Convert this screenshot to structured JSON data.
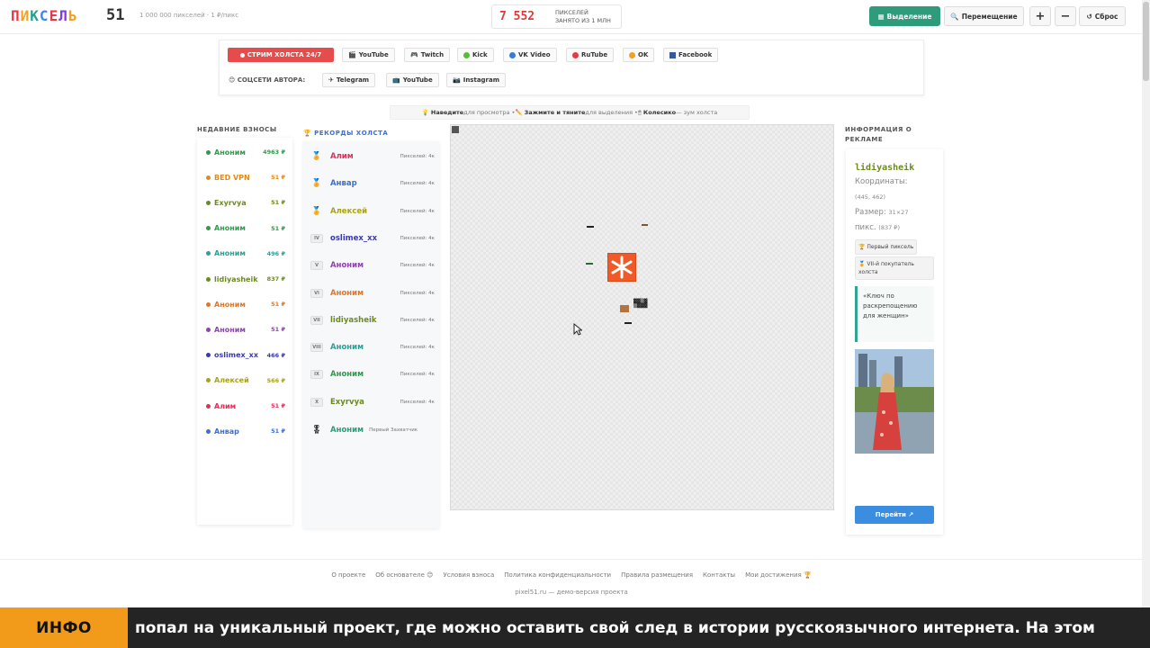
{
  "header": {
    "logo_letters": [
      "П",
      "И",
      "К",
      "С",
      "Е",
      "Л",
      "Ь"
    ],
    "logo_colors": [
      "#e63946",
      "#f4a020",
      "#2a9d8f",
      "#3a86ff",
      "#e63946",
      "#8338ec",
      "#f4a020"
    ],
    "logo_number": "51",
    "subtitle": "1 000 000 пикселей · 1 ₽/пикс",
    "counter_value": "7 552",
    "counter_caption_1": "пикселей",
    "counter_caption_2": "занято из 1 млн",
    "btn_select": "Выделение",
    "btn_move": "Перемещение",
    "btn_zoom_in": "+",
    "btn_zoom_out": "−",
    "btn_reset": "Сброс"
  },
  "streams": {
    "live_label": "СТРИМ ХОЛСТА 24/7",
    "platforms": [
      "YouTube",
      "Twitch",
      "Kick",
      "VK Video",
      "RuTube",
      "OK",
      "Facebook"
    ],
    "socials_label": "СОЦСЕТИ АВТОРА:",
    "socials": [
      "Telegram",
      "YouTube",
      "Instagram"
    ]
  },
  "hint": {
    "part1_bold": "Наведите",
    "part1": " для просмотра • ",
    "part2_bold": "Зажмите и тяните",
    "part2": " для выделения • ",
    "part3_bold": "Колесико",
    "part3": " — зум холста"
  },
  "recent": {
    "title": "Недавние взносы",
    "items": [
      {
        "name": "Аноним",
        "amount": "4963 ₽",
        "color": "#2e9c4a"
      },
      {
        "name": "BED VPN",
        "amount": "51 ₽",
        "color": "#e08a1a"
      },
      {
        "name": "Exyrvya",
        "amount": "51 ₽",
        "color": "#6c8b1e"
      },
      {
        "name": "Аноним",
        "amount": "51 ₽",
        "color": "#2e9c4a"
      },
      {
        "name": "Аноним",
        "amount": "496 ₽",
        "color": "#2aa198"
      },
      {
        "name": "lidiyasheik",
        "amount": "837 ₽",
        "color": "#6c8b1e"
      },
      {
        "name": "Аноним",
        "amount": "51 ₽",
        "color": "#e0762a"
      },
      {
        "name": "Аноним",
        "amount": "51 ₽",
        "color": "#8e44ad"
      },
      {
        "name": "oslimex_xx",
        "amount": "466 ₽",
        "color": "#3a3ab0"
      },
      {
        "name": "Алексей",
        "amount": "566 ₽",
        "color": "#a8a21e"
      },
      {
        "name": "Алим",
        "amount": "51 ₽",
        "color": "#e0305a"
      },
      {
        "name": "Анвар",
        "amount": "51 ₽",
        "color": "#3a6fd8"
      }
    ]
  },
  "records": {
    "title": "Рекорды холста",
    "items": [
      {
        "rank": "🏅",
        "name": "Алим",
        "sub": "Пикселей: 4к",
        "color": "#e0305a"
      },
      {
        "rank": "🏅",
        "name": "Анвар",
        "sub": "Пикселей: 4к",
        "color": "#3a6fd8"
      },
      {
        "rank": "🏅",
        "name": "Алексей",
        "sub": "Пикселей: 4к",
        "color": "#a8a21e"
      },
      {
        "rank": "IV",
        "name": "oslimex_xx",
        "sub": "Пикселей: 4к",
        "color": "#3a3ab0"
      },
      {
        "rank": "V",
        "name": "Аноним",
        "sub": "Пикселей: 4к",
        "color": "#8e44ad"
      },
      {
        "rank": "VI",
        "name": "Аноним",
        "sub": "Пикселей: 4к",
        "color": "#e0762a"
      },
      {
        "rank": "VII",
        "name": "lidiyasheik",
        "sub": "Пикселей: 4к",
        "color": "#6c8b1e"
      },
      {
        "rank": "VIII",
        "name": "Аноним",
        "sub": "Пикселей: 4к",
        "color": "#2aa198"
      },
      {
        "rank": "IX",
        "name": "Аноним",
        "sub": "Пикселей: 4к",
        "color": "#2e9c4a"
      },
      {
        "rank": "X",
        "name": "Exyrvya",
        "sub": "Пикселей: 4к",
        "color": "#6c8b1e"
      }
    ],
    "first_icon": "🎖",
    "first_name": "Аноним",
    "first_sub": "Первый Захватчик"
  },
  "ad": {
    "title": "Информация о рекламе",
    "user": "lidiyasheik",
    "coords_label": "Координаты:",
    "coords_value": "(445, 462)",
    "size_label": "Размер:",
    "size_value": "31×27",
    "size_px": "пикс.",
    "size_price": "(837 ₽)",
    "tag1": "🏆 Первый пиксель",
    "tag2": "🏅 VII-й покупатель холста",
    "quote": "«Ключ по раскрепощению для женщин»",
    "button": "Перейти ↗"
  },
  "footer": {
    "links": [
      "О проекте",
      "Об основателе 😊",
      "Условия взноса",
      "Политика конфиденциальности",
      "Правила размещения",
      "Контакты",
      "Мои достижения 🏆"
    ],
    "sub": "pixel51.ru — демо-версия проекта"
  },
  "ticker": {
    "tag": "ИНФО",
    "text": "попал на уникальный проект, где можно оставить свой след в истории русскоязычного интернета. На этом"
  },
  "colors": {
    "accent": "#2e9c7a",
    "live": "#e74c4c",
    "counter": "#d83c3c",
    "ticker_tag": "#f29a1a",
    "ad_button": "#3b8de0"
  }
}
